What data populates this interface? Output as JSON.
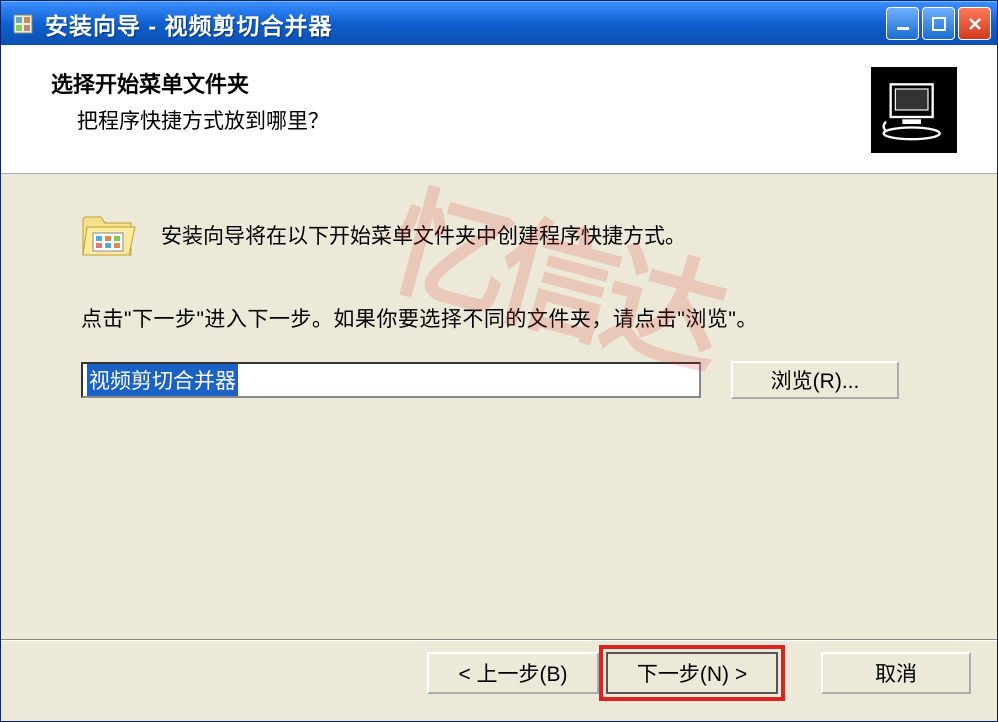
{
  "titlebar": {
    "title": "安装向导 - 视频剪切合并器"
  },
  "header": {
    "title": "选择开始菜单文件夹",
    "subtitle": "把程序快捷方式放到哪里？"
  },
  "content": {
    "line1": "安装向导将在以下开始菜单文件夹中创建程序快捷方式。",
    "line2": "点击\"下一步\"进入下一步。如果你要选择不同的文件夹，请点击\"浏览\"。",
    "path_value": "视频剪切合并器",
    "browse_label": "浏览(R)..."
  },
  "buttons": {
    "back": "< 上一步(B)",
    "next": "下一步(N) >",
    "cancel": "取消"
  },
  "watermark": "忆信达"
}
